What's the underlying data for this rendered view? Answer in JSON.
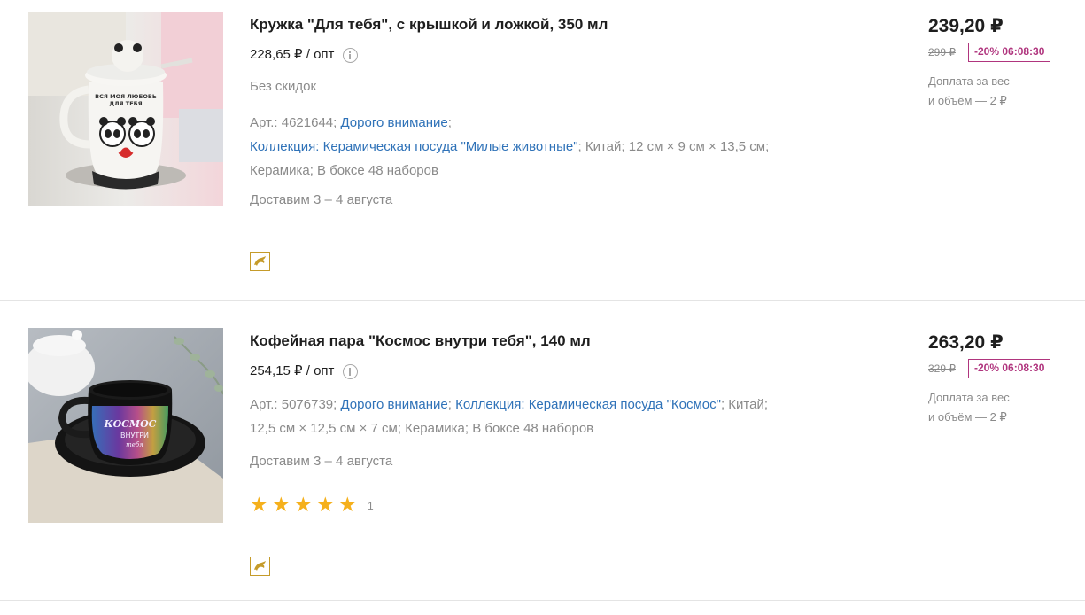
{
  "products": [
    {
      "title": "Кружка \"Для тебя\", с крышкой и ложкой, 350 мл",
      "opt_price": "228,65 ₽ / опт",
      "no_discount": "Без скидок",
      "article": "Арт.: 4621644;",
      "link_expensive": "Дорого внимание",
      "sep1": ";",
      "collection": "Коллекция: Керамическая посуда \"Милые животные\"",
      "attrs_rest_1": "; Китай; 12 см × 9 см × 13,5 см;",
      "attrs_rest_2": "Керамика; В боксе 48 наборов",
      "delivery": "Доставим 3 – 4 августа",
      "price": "239,20 ₽",
      "old_price": "299 ₽",
      "promo": "-20% 06:08:30",
      "fee_line1": "Доплата за вес",
      "fee_line2": "и объём — 2 ₽",
      "mug_text_1": "ВСЯ МОЯ ЛЮБОВЬ",
      "mug_text_2": "ДЛЯ ТЕБЯ",
      "badge_icon": "dolphin-icon"
    },
    {
      "title": "Кофейная пара \"Космос внутри тебя\", 140 мл",
      "opt_price": "254,15 ₽ / опт",
      "article": "Арт.: 5076739;",
      "link_expensive": "Дорого внимание",
      "sep1": ";",
      "collection": "Коллекция: Керамическая посуда \"Космос\"",
      "attrs_rest_1": "; Китай;",
      "attrs_rest_2": "12,5 см × 12,5 см × 7 см; Керамика; В боксе 48 наборов",
      "delivery": "Доставим 3 – 4 августа",
      "rating": 5,
      "rating_max": 5,
      "rating_count": "1",
      "price": "263,20 ₽",
      "old_price": "329 ₽",
      "promo": "-20% 06:08:30",
      "fee_line1": "Доплата за вес",
      "fee_line2": "и объём — 2 ₽",
      "cup_text_1": "КОСМОС",
      "cup_text_2": "ВНУТРИ",
      "cup_text_3": "тебя",
      "badge_icon": "dolphin-icon"
    }
  ],
  "colors": {
    "link": "#2f72b8",
    "promo": "#b0357e",
    "star": "#f5b01c",
    "badge": "#c59b2a"
  }
}
